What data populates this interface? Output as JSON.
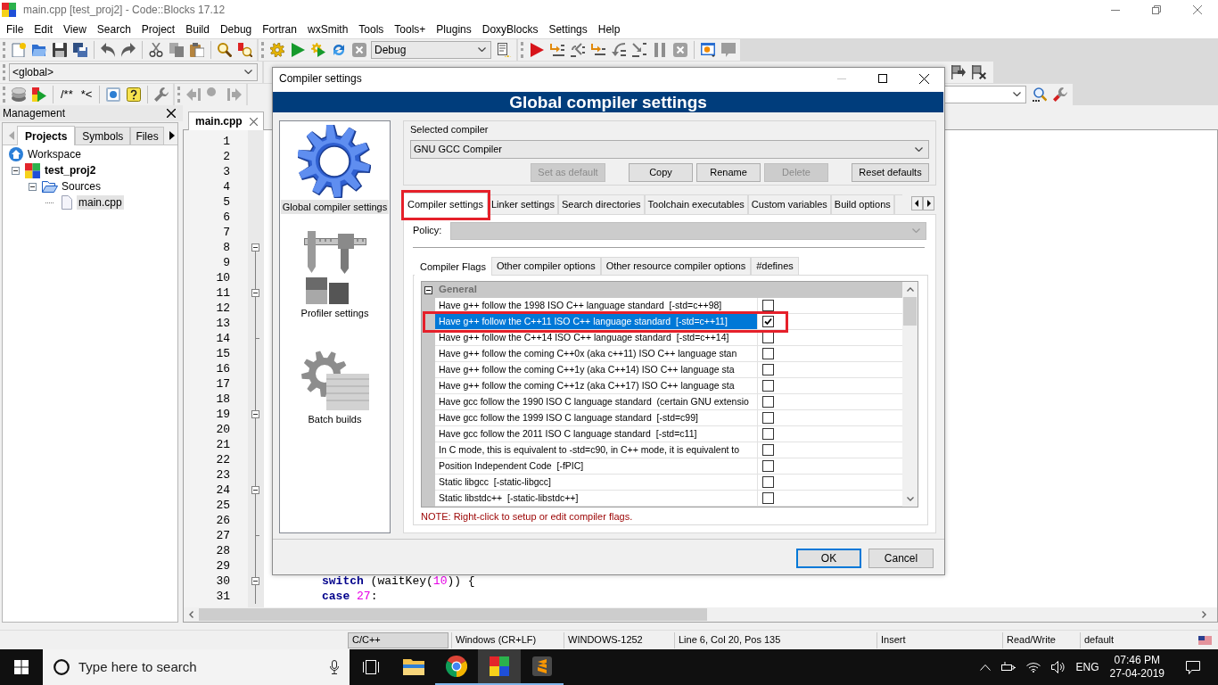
{
  "window": {
    "title": "main.cpp [test_proj2] - Code::Blocks 17.12"
  },
  "menu": [
    "File",
    "Edit",
    "View",
    "Search",
    "Project",
    "Build",
    "Debug",
    "Fortran",
    "wxSmith",
    "Tools",
    "Tools+",
    "Plugins",
    "DoxyBlocks",
    "Settings",
    "Help"
  ],
  "toolbar": {
    "build_target": "Debug",
    "scope": "<global>",
    "comment_buttons": [
      "/**",
      "*<"
    ]
  },
  "management": {
    "title": "Management",
    "tabs": [
      {
        "label": "Projects",
        "selected": true
      },
      {
        "label": "Symbols",
        "selected": false
      },
      {
        "label": "Files",
        "selected": false
      }
    ],
    "tree": [
      {
        "label": "Workspace",
        "kind": "workspace",
        "selected": false,
        "children": [
          {
            "label": "test_proj2",
            "kind": "project",
            "expanded": true,
            "selected": false,
            "children": [
              {
                "label": "Sources",
                "kind": "folder",
                "expanded": true,
                "selected": false,
                "children": [
                  {
                    "label": "main.cpp",
                    "kind": "file",
                    "selected": true
                  }
                ]
              }
            ]
          }
        ]
      }
    ]
  },
  "editor": {
    "file_tab": "main.cpp",
    "lines": [
      {
        "number": "1",
        "kind": "plain"
      },
      {
        "number": "2",
        "kind": "plain"
      },
      {
        "number": "3",
        "kind": "plain"
      },
      {
        "number": "4",
        "kind": "plain"
      },
      {
        "number": "5",
        "kind": "plain"
      },
      {
        "number": "6",
        "kind": "plain"
      },
      {
        "number": "7",
        "kind": "plain"
      },
      {
        "number": "8",
        "kind": "fold_start"
      },
      {
        "number": "9",
        "kind": "fold_body"
      },
      {
        "number": "10",
        "kind": "fold_body"
      },
      {
        "number": "11",
        "kind": "fold_start"
      },
      {
        "number": "12",
        "kind": "fold_body"
      },
      {
        "number": "13",
        "kind": "fold_body"
      },
      {
        "number": "14",
        "kind": "fold_end"
      },
      {
        "number": "15",
        "kind": "fold_body"
      },
      {
        "number": "16",
        "kind": "fold_body"
      },
      {
        "number": "17",
        "kind": "fold_body"
      },
      {
        "number": "18",
        "kind": "fold_body"
      },
      {
        "number": "19",
        "kind": "fold_start"
      },
      {
        "number": "20",
        "kind": "fold_body"
      },
      {
        "number": "21",
        "kind": "fold_body"
      },
      {
        "number": "22",
        "kind": "fold_body"
      },
      {
        "number": "23",
        "kind": "fold_body"
      },
      {
        "number": "24",
        "kind": "fold_start"
      },
      {
        "number": "25",
        "kind": "fold_body"
      },
      {
        "number": "26",
        "kind": "fold_body"
      },
      {
        "number": "27",
        "kind": "fold_end"
      },
      {
        "number": "28",
        "kind": "fold_body"
      },
      {
        "number": "29",
        "kind": "fold_body"
      },
      {
        "number": "30",
        "kind": "fold_start",
        "code": [
          {
            "kind": "keyword",
            "text": "switch "
          },
          {
            "kind": "plain",
            "text": "(waitKey("
          },
          {
            "kind": "number",
            "text": "10"
          },
          {
            "kind": "plain",
            "text": ")) {"
          }
        ]
      },
      {
        "number": "31",
        "kind": "fold_body",
        "code": [
          {
            "kind": "keyword",
            "text": "case "
          },
          {
            "kind": "number",
            "text": "27"
          },
          {
            "kind": "plain",
            "text": ":"
          }
        ]
      }
    ]
  },
  "dialog": {
    "title": "Compiler settings",
    "header": "Global compiler settings",
    "categories": [
      {
        "label": "Global compiler settings",
        "kind": "gear",
        "selected": true
      },
      {
        "label": "Profiler settings",
        "kind": "caliper",
        "selected": false
      },
      {
        "label": "Batch builds",
        "kind": "batch",
        "selected": false
      }
    ],
    "compiler": {
      "label": "Selected compiler",
      "value": "GNU GCC Compiler",
      "buttons": [
        {
          "label": "Set as default",
          "disabled": true
        },
        {
          "label": "Copy",
          "disabled": false
        },
        {
          "label": "Rename",
          "disabled": false
        },
        {
          "label": "Delete",
          "disabled": true
        },
        {
          "label": "Reset defaults",
          "disabled": false
        }
      ]
    },
    "tabs": [
      {
        "label": "Compiler settings",
        "selected": true,
        "annotated": true
      },
      {
        "label": "Linker settings",
        "selected": false,
        "annotated": false
      },
      {
        "label": "Search directories",
        "selected": false,
        "annotated": false
      },
      {
        "label": "Toolchain executables",
        "selected": false,
        "annotated": false
      },
      {
        "label": "Custom variables",
        "selected": false,
        "annotated": false
      },
      {
        "label": "Build options",
        "selected": false,
        "annotated": false
      }
    ],
    "policy": {
      "label": "Policy:",
      "disabled": true
    },
    "flag_tabs": [
      {
        "label": "Compiler Flags",
        "selected": true
      },
      {
        "label": "Other compiler options",
        "selected": false
      },
      {
        "label": "Other resource compiler options",
        "selected": false
      },
      {
        "label": "#defines",
        "selected": false
      }
    ],
    "flags": {
      "category": "General",
      "expanded": true,
      "rows": [
        {
          "label": "Have g++ follow the 1998 ISO C++ language standard  [-std=c++98]",
          "checked": false,
          "selected": false,
          "annotated": false
        },
        {
          "label": "Have g++ follow the C++11 ISO C++ language standard  [-std=c++11]",
          "checked": true,
          "selected": true,
          "annotated": true
        },
        {
          "label": "Have g++ follow the C++14 ISO C++ language standard  [-std=c++14]",
          "checked": false,
          "selected": false,
          "annotated": false
        },
        {
          "label": "Have g++ follow the coming C++0x (aka c++11) ISO C++ language stan",
          "checked": false,
          "selected": false,
          "annotated": false
        },
        {
          "label": "Have g++ follow the coming C++1y (aka C++14) ISO C++ language sta",
          "checked": false,
          "selected": false,
          "annotated": false
        },
        {
          "label": "Have g++ follow the coming C++1z (aka C++17) ISO C++ language sta",
          "checked": false,
          "selected": false,
          "annotated": false
        },
        {
          "label": "Have gcc follow the 1990 ISO C language standard  (certain GNU extensio",
          "checked": false,
          "selected": false,
          "annotated": false
        },
        {
          "label": "Have gcc follow the 1999 ISO C language standard  [-std=c99]",
          "checked": false,
          "selected": false,
          "annotated": false
        },
        {
          "label": "Have gcc follow the 2011 ISO C language standard  [-std=c11]",
          "checked": false,
          "selected": false,
          "annotated": false
        },
        {
          "label": "In C mode, this is equivalent to -std=c90, in C++ mode, it is equivalent to",
          "checked": false,
          "selected": false,
          "annotated": false
        },
        {
          "label": "Position Independent Code  [-fPIC]",
          "checked": false,
          "selected": false,
          "annotated": false
        },
        {
          "label": "Static libgcc  [-static-libgcc]",
          "checked": false,
          "selected": false,
          "annotated": false
        },
        {
          "label": "Static libstdc++  [-static-libstdc++]",
          "checked": false,
          "selected": false,
          "annotated": false
        }
      ]
    },
    "note": "NOTE: Right-click to setup or edit compiler flags.",
    "buttons": [
      {
        "label": "OK",
        "default": true
      },
      {
        "label": "Cancel",
        "default": false
      }
    ]
  },
  "status_bar": [
    {
      "text": "C/C++",
      "kind": "sunken"
    },
    {
      "text": "Windows (CR+LF)",
      "kind": "plain"
    },
    {
      "text": "WINDOWS-1252",
      "kind": "plain"
    },
    {
      "text": "Line 6, Col 20, Pos 135",
      "kind": "plain"
    },
    {
      "text": "Insert",
      "kind": "plain"
    },
    {
      "text": "Read/Write",
      "kind": "plain"
    },
    {
      "text": "default",
      "kind": "plain"
    }
  ],
  "taskbar": {
    "search_placeholder": "Type here to search",
    "apps": [
      {
        "kind": "folder",
        "selected": false,
        "running": false
      },
      {
        "kind": "browser",
        "selected": false,
        "running": true
      },
      {
        "kind": "ide",
        "selected": true,
        "running": true
      },
      {
        "kind": "editor",
        "selected": false,
        "running": true
      }
    ],
    "language": "ENG",
    "time": "07:46 PM",
    "date": "27-04-2019"
  }
}
